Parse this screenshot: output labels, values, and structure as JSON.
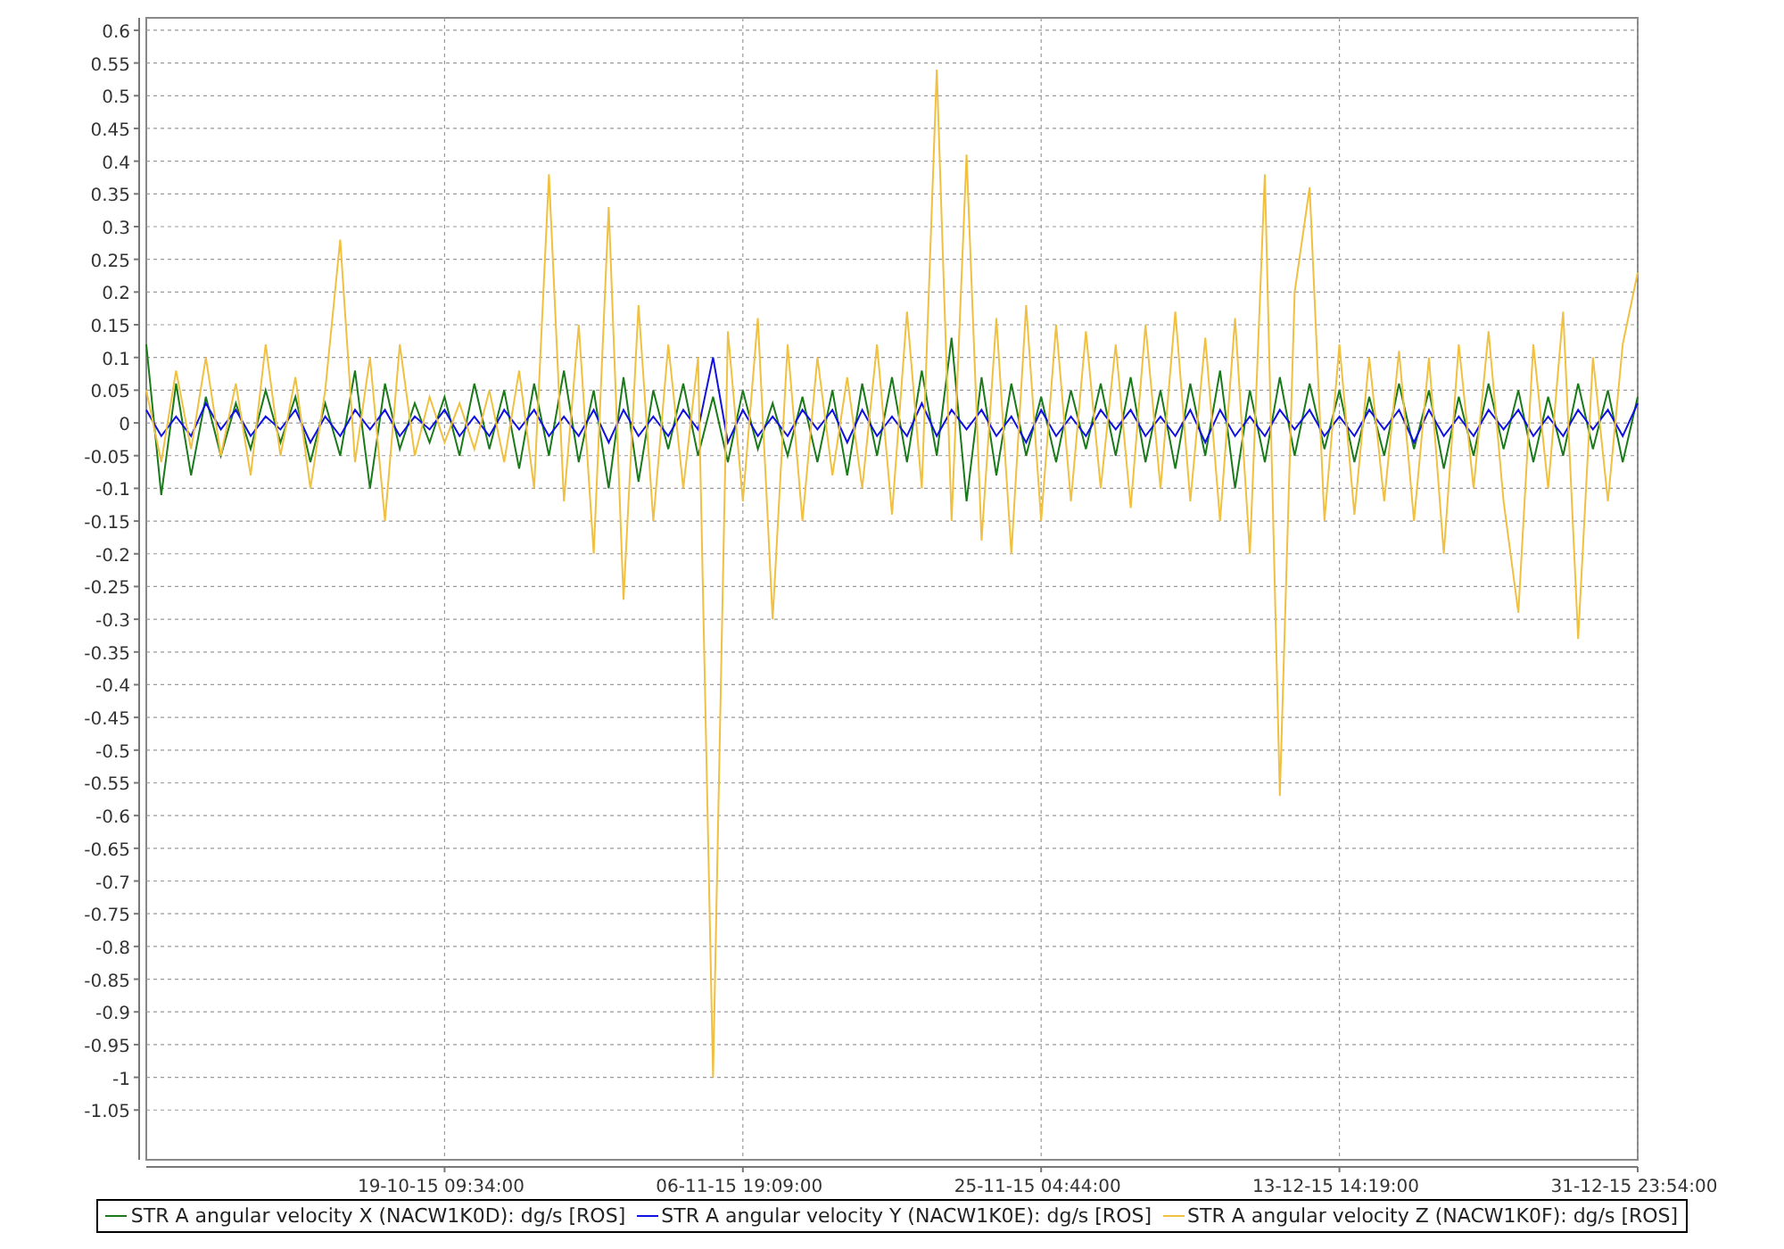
{
  "chart_data": {
    "type": "line",
    "grid": true,
    "ylim": [
      -1.126,
      0.619
    ],
    "yticks": [
      0.6,
      0.55,
      0.5,
      0.45,
      0.4,
      0.35,
      0.3,
      0.25,
      0.2,
      0.15,
      0.1,
      0.05,
      0,
      -0.05,
      -0.1,
      -0.15,
      -0.2,
      -0.25,
      -0.3,
      -0.35,
      -0.4,
      -0.45,
      -0.5,
      -0.55,
      -0.6,
      -0.65,
      -0.7,
      -0.75,
      -0.8,
      -0.85,
      -0.9,
      -0.95,
      -1,
      -1.05
    ],
    "categories": [
      null,
      null,
      null,
      null,
      null,
      null,
      null,
      null,
      null,
      null,
      null,
      null,
      null,
      null,
      null,
      null,
      null,
      null,
      null,
      null,
      "19-10-15 09:34:00",
      null,
      null,
      null,
      null,
      null,
      null,
      null,
      null,
      null,
      null,
      null,
      null,
      null,
      null,
      null,
      null,
      null,
      null,
      null,
      "06-11-15 19:09:00",
      null,
      null,
      null,
      null,
      null,
      null,
      null,
      null,
      null,
      null,
      null,
      null,
      null,
      null,
      null,
      null,
      null,
      null,
      null,
      "25-11-15 04:44:00",
      null,
      null,
      null,
      null,
      null,
      null,
      null,
      null,
      null,
      null,
      null,
      null,
      null,
      null,
      null,
      null,
      null,
      null,
      null,
      "13-12-15 14:19:00",
      null,
      null,
      null,
      null,
      null,
      null,
      null,
      null,
      null,
      null,
      null,
      null,
      null,
      null,
      null,
      null,
      null,
      null,
      null,
      "31-12-15 23:54:00"
    ],
    "series": [
      {
        "name": "STR A angular velocity X (NACW1K0D): dg/s [ROS]",
        "color": "#1a7a1a",
        "values": [
          0.12,
          -0.11,
          0.06,
          -0.08,
          0.04,
          -0.05,
          0.03,
          -0.04,
          0.05,
          -0.03,
          0.04,
          -0.06,
          0.03,
          -0.05,
          0.08,
          -0.1,
          0.06,
          -0.04,
          0.03,
          -0.03,
          0.04,
          -0.05,
          0.06,
          -0.04,
          0.05,
          -0.07,
          0.06,
          -0.05,
          0.08,
          -0.06,
          0.05,
          -0.1,
          0.07,
          -0.09,
          0.05,
          -0.04,
          0.06,
          -0.05,
          0.04,
          -0.06,
          0.05,
          -0.04,
          0.03,
          -0.05,
          0.04,
          -0.06,
          0.05,
          -0.08,
          0.06,
          -0.05,
          0.07,
          -0.06,
          0.08,
          -0.05,
          0.13,
          -0.12,
          0.07,
          -0.08,
          0.06,
          -0.05,
          0.04,
          -0.06,
          0.05,
          -0.04,
          0.06,
          -0.05,
          0.07,
          -0.06,
          0.05,
          -0.07,
          0.06,
          -0.05,
          0.08,
          -0.1,
          0.05,
          -0.06,
          0.07,
          -0.05,
          0.06,
          -0.04,
          0.05,
          -0.06,
          0.04,
          -0.05,
          0.06,
          -0.04,
          0.05,
          -0.07,
          0.04,
          -0.05,
          0.06,
          -0.04,
          0.05,
          -0.06,
          0.04,
          -0.05,
          0.06,
          -0.04,
          0.05,
          -0.06,
          0.04
        ]
      },
      {
        "name": "STR A angular velocity Y (NACW1K0E): dg/s [ROS]",
        "color": "#1010e0",
        "values": [
          0.02,
          -0.02,
          0.01,
          -0.02,
          0.03,
          -0.01,
          0.02,
          -0.02,
          0.01,
          -0.01,
          0.02,
          -0.03,
          0.01,
          -0.02,
          0.02,
          -0.01,
          0.02,
          -0.02,
          0.01,
          -0.01,
          0.02,
          -0.02,
          0.01,
          -0.02,
          0.02,
          -0.01,
          0.02,
          -0.02,
          0.01,
          -0.02,
          0.02,
          -0.03,
          0.02,
          -0.02,
          0.01,
          -0.02,
          0.02,
          -0.01,
          0.1,
          -0.03,
          0.02,
          -0.02,
          0.01,
          -0.02,
          0.02,
          -0.01,
          0.02,
          -0.03,
          0.02,
          -0.02,
          0.01,
          -0.02,
          0.03,
          -0.02,
          0.02,
          -0.01,
          0.02,
          -0.02,
          0.01,
          -0.03,
          0.02,
          -0.02,
          0.01,
          -0.02,
          0.02,
          -0.01,
          0.02,
          -0.02,
          0.01,
          -0.02,
          0.02,
          -0.03,
          0.02,
          -0.02,
          0.01,
          -0.02,
          0.02,
          -0.01,
          0.02,
          -0.02,
          0.01,
          -0.02,
          0.02,
          -0.01,
          0.02,
          -0.03,
          0.02,
          -0.02,
          0.01,
          -0.02,
          0.02,
          -0.01,
          0.02,
          -0.02,
          0.01,
          -0.02,
          0.02,
          -0.01,
          0.02,
          -0.02,
          0.03
        ]
      },
      {
        "name": "STR A angular velocity Z (NACW1K0F): dg/s [ROS]",
        "color": "#f0c040",
        "values": [
          0.05,
          -0.06,
          0.08,
          -0.04,
          0.1,
          -0.05,
          0.06,
          -0.08,
          0.12,
          -0.05,
          0.07,
          -0.1,
          0.05,
          0.28,
          -0.06,
          0.1,
          -0.15,
          0.12,
          -0.05,
          0.04,
          -0.03,
          0.03,
          -0.04,
          0.05,
          -0.06,
          0.08,
          -0.1,
          0.38,
          -0.12,
          0.15,
          -0.2,
          0.33,
          -0.27,
          0.18,
          -0.15,
          0.12,
          -0.1,
          0.1,
          -1.0,
          0.14,
          -0.12,
          0.16,
          -0.3,
          0.12,
          -0.15,
          0.1,
          -0.08,
          0.07,
          -0.1,
          0.12,
          -0.14,
          0.17,
          -0.1,
          0.54,
          -0.15,
          0.41,
          -0.18,
          0.16,
          -0.2,
          0.18,
          -0.15,
          0.15,
          -0.12,
          0.14,
          -0.1,
          0.12,
          -0.13,
          0.15,
          -0.1,
          0.17,
          -0.12,
          0.13,
          -0.15,
          0.16,
          -0.2,
          0.38,
          -0.57,
          0.2,
          0.36,
          -0.15,
          0.12,
          -0.14,
          0.1,
          -0.12,
          0.11,
          -0.15,
          0.1,
          -0.2,
          0.12,
          -0.1,
          0.14,
          -0.12,
          -0.29,
          0.12,
          -0.1,
          0.17,
          -0.33,
          0.1,
          -0.12,
          0.12,
          0.23
        ]
      }
    ]
  }
}
